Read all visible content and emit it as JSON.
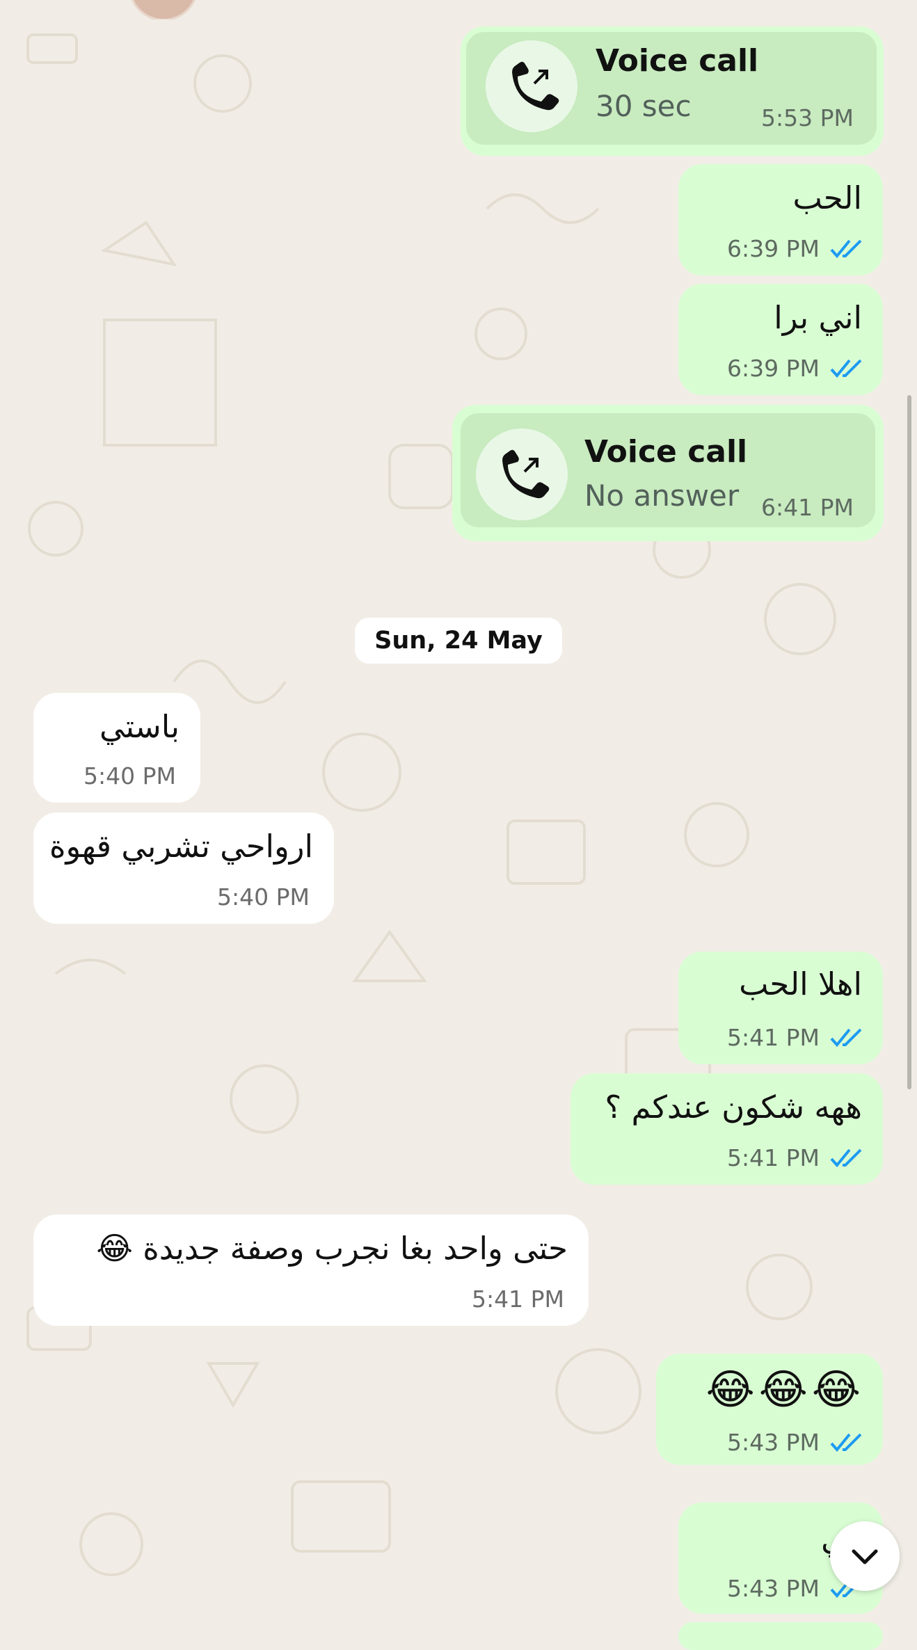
{
  "chat": {
    "messages": [
      {
        "kind": "call",
        "direction": "out",
        "title": "Voice call",
        "subtitle": "30 sec",
        "time": "5:53 PM"
      },
      {
        "kind": "text",
        "direction": "out",
        "text": "الحب",
        "time": "6:39 PM",
        "status": "read"
      },
      {
        "kind": "text",
        "direction": "out",
        "text": "اني برا",
        "time": "6:39 PM",
        "status": "read"
      },
      {
        "kind": "call",
        "direction": "out",
        "title": "Voice call",
        "subtitle": "No answer",
        "time": "6:41 PM"
      },
      {
        "kind": "date",
        "label": "Sun, 24 May"
      },
      {
        "kind": "text",
        "direction": "in",
        "text": "باستي",
        "time": "5:40 PM"
      },
      {
        "kind": "text",
        "direction": "in",
        "text": "ارواحي تشربي قهوة",
        "time": "5:40 PM"
      },
      {
        "kind": "text",
        "direction": "out",
        "text": "اهلا الحب",
        "time": "5:41 PM",
        "status": "read"
      },
      {
        "kind": "text",
        "direction": "out",
        "text": "ههه شكون عندكم ؟",
        "time": "5:41 PM",
        "status": "read"
      },
      {
        "kind": "text",
        "direction": "in",
        "text": "حتى واحد بغا نجرب وصفة جديدة 😂",
        "time": "5:41 PM"
      },
      {
        "kind": "text",
        "direction": "out",
        "text": "😂😂😂",
        "time": "5:43 PM",
        "status": "read"
      },
      {
        "kind": "text",
        "direction": "out",
        "text": "كي",
        "time": "5:43 PM",
        "status": "read"
      }
    ]
  },
  "colors": {
    "background": "#f1ede6",
    "outgoing_bubble": "#d9fdd3",
    "incoming_bubble": "#ffffff",
    "read_ticks": "#1d9bf0"
  },
  "icons": {
    "call": "outgoing-call-icon",
    "ticks": "double-check-icon",
    "scroll": "chevron-down-icon"
  }
}
